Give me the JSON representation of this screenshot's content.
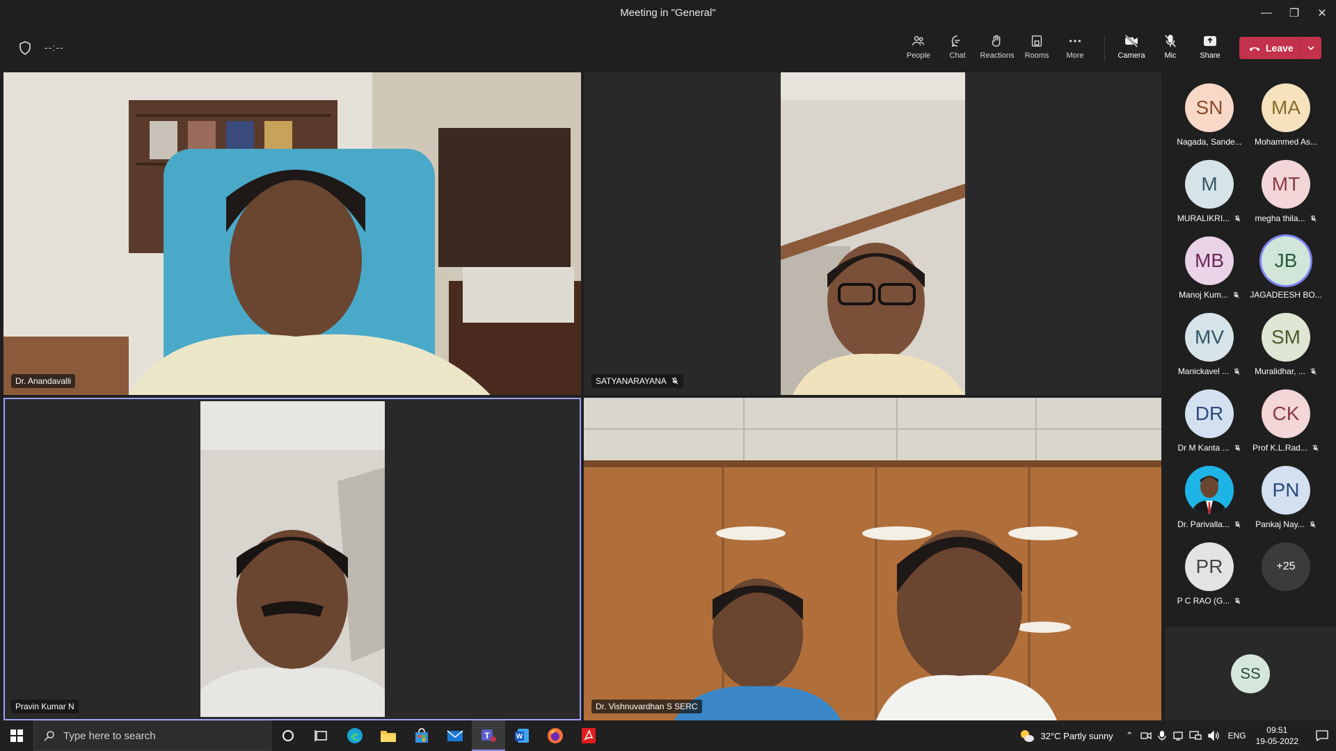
{
  "window": {
    "title": "Meeting in \"General\""
  },
  "toolbar": {
    "timer": "--:--",
    "buttons": [
      {
        "label": "People",
        "icon": "people-icon"
      },
      {
        "label": "Chat",
        "icon": "chat-icon"
      },
      {
        "label": "Reactions",
        "icon": "reactions-icon"
      },
      {
        "label": "Rooms",
        "icon": "rooms-icon"
      },
      {
        "label": "More",
        "icon": "more-icon"
      },
      {
        "label": "Camera",
        "icon": "camera-off-icon"
      },
      {
        "label": "Mic",
        "icon": "mic-off-icon"
      },
      {
        "label": "Share",
        "icon": "share-icon"
      }
    ],
    "leave_label": "Leave",
    "leave_color": "#c4314b"
  },
  "tiles": [
    {
      "name": "Dr. Anandavalli",
      "muted": false
    },
    {
      "name": "SATYANARAYANA",
      "muted": true
    },
    {
      "name": "Pravin Kumar N",
      "muted": false
    },
    {
      "name": "Dr. Vishnuvardhan S SERC",
      "muted": false
    }
  ],
  "roster": [
    {
      "initials": "SN",
      "name": "Nagada, Sande...",
      "muted": false,
      "color": "#f8d9c8"
    },
    {
      "initials": "MA",
      "name": "Mohammed As...",
      "muted": false,
      "color": "#f6e2bd"
    },
    {
      "initials": "M",
      "name": "MURALIKRI...",
      "muted": true,
      "color": "#d6e4ea"
    },
    {
      "initials": "MT",
      "name": "megha thila...",
      "muted": true,
      "color": "#f3d6d8"
    },
    {
      "initials": "MB",
      "name": "Manoj Kum...",
      "muted": true,
      "color": "#ead3e6"
    },
    {
      "initials": "JB",
      "name": "JAGADEESH BO...",
      "muted": false,
      "color": "#d1e6d9"
    },
    {
      "initials": "MV",
      "name": "Manickavel ...",
      "muted": true,
      "color": "#d6e4ea"
    },
    {
      "initials": "SM",
      "name": "Muralidhar, ...",
      "muted": true,
      "color": "#dfe6d3"
    },
    {
      "initials": "DR",
      "name": "Dr M Kanta ...",
      "muted": true,
      "color": "#d3e0f0"
    },
    {
      "initials": "CK",
      "name": "Prof K.L.Rad...",
      "muted": true,
      "color": "#f3d6d8"
    },
    {
      "initials": "",
      "name": "Dr. Parivalla...",
      "muted": true,
      "color": "#1fb4e6"
    },
    {
      "initials": "PN",
      "name": "Pankaj Nay...",
      "muted": true,
      "color": "#d3e0f0"
    },
    {
      "initials": "PR",
      "name": "P C RAO (G...",
      "muted": true,
      "color": "#e3e3e3"
    },
    {
      "initials": "+25",
      "name": "",
      "muted": false,
      "color": "#3b3b3b"
    }
  ],
  "self_tile": {
    "initials": "SS",
    "color": "#d5e6da"
  },
  "taskbar": {
    "search_placeholder": "Type here to search",
    "weather": "32°C  Partly sunny",
    "lang": "ENG",
    "time": "09:51",
    "date": "19-05-2022"
  }
}
